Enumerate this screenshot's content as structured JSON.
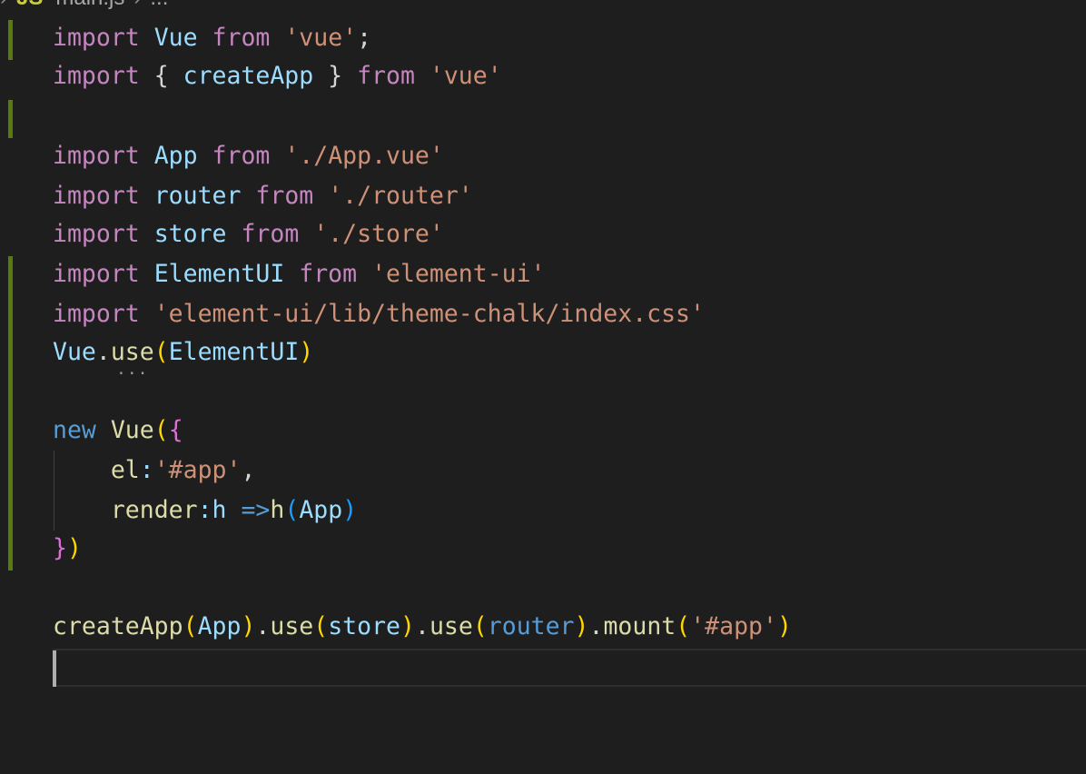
{
  "breadcrumb": {
    "file_icon_text": "JS",
    "file_name": "main.js",
    "trailing": "..."
  },
  "editor": {
    "lines": [
      {
        "tokens": [
          [
            "kw-ctrl",
            "import"
          ],
          [
            "p",
            " "
          ],
          [
            "id",
            "Vue"
          ],
          [
            "p",
            " "
          ],
          [
            "kw-ctrl",
            "from"
          ],
          [
            "p",
            " "
          ],
          [
            "str",
            "'vue'"
          ],
          [
            "p",
            ";"
          ]
        ]
      },
      {
        "tokens": [
          [
            "kw-ctrl",
            "import"
          ],
          [
            "p",
            " { "
          ],
          [
            "id",
            "createApp"
          ],
          [
            "p",
            " } "
          ],
          [
            "kw-ctrl",
            "from"
          ],
          [
            "p",
            " "
          ],
          [
            "str",
            "'vue'"
          ]
        ]
      },
      {
        "tokens": []
      },
      {
        "tokens": [
          [
            "kw-ctrl",
            "import"
          ],
          [
            "p",
            " "
          ],
          [
            "id",
            "App"
          ],
          [
            "p",
            " "
          ],
          [
            "kw-ctrl",
            "from"
          ],
          [
            "p",
            " "
          ],
          [
            "str",
            "'./App.vue'"
          ]
        ]
      },
      {
        "tokens": [
          [
            "kw-ctrl",
            "import"
          ],
          [
            "p",
            " "
          ],
          [
            "id",
            "router"
          ],
          [
            "p",
            " "
          ],
          [
            "kw-ctrl",
            "from"
          ],
          [
            "p",
            " "
          ],
          [
            "str",
            "'./router'"
          ]
        ]
      },
      {
        "tokens": [
          [
            "kw-ctrl",
            "import"
          ],
          [
            "p",
            " "
          ],
          [
            "id",
            "store"
          ],
          [
            "p",
            " "
          ],
          [
            "kw-ctrl",
            "from"
          ],
          [
            "p",
            " "
          ],
          [
            "str",
            "'./store'"
          ]
        ]
      },
      {
        "tokens": [
          [
            "kw-ctrl",
            "import"
          ],
          [
            "p",
            " "
          ],
          [
            "id",
            "ElementUI"
          ],
          [
            "p",
            " "
          ],
          [
            "kw-ctrl",
            "from"
          ],
          [
            "p",
            " "
          ],
          [
            "str",
            "'element-ui'"
          ]
        ]
      },
      {
        "tokens": [
          [
            "kw-ctrl",
            "import"
          ],
          [
            "p",
            " "
          ],
          [
            "str",
            "'element-ui/lib/theme-chalk/index.css'"
          ]
        ]
      },
      {
        "tokens": [
          [
            "id",
            "Vue"
          ],
          [
            "p",
            "."
          ],
          [
            "fn",
            "use"
          ],
          [
            "b1",
            "("
          ],
          [
            "id",
            "ElementUI"
          ],
          [
            "b1",
            ")"
          ]
        ]
      },
      {
        "tokens": []
      },
      {
        "tokens": [
          [
            "kw",
            "new"
          ],
          [
            "p",
            " "
          ],
          [
            "fn",
            "Vue"
          ],
          [
            "b1",
            "("
          ],
          [
            "b2",
            "{"
          ]
        ]
      },
      {
        "tokens": [
          [
            "p",
            "    "
          ],
          [
            "fn",
            "el"
          ],
          [
            "id",
            ":"
          ],
          [
            "str",
            "'#app'"
          ],
          [
            "p",
            ","
          ]
        ]
      },
      {
        "tokens": [
          [
            "p",
            "    "
          ],
          [
            "fn",
            "render"
          ],
          [
            "id",
            ":h"
          ],
          [
            "p",
            " "
          ],
          [
            "kw",
            "=>"
          ],
          [
            "fn",
            "h"
          ],
          [
            "b3",
            "("
          ],
          [
            "id",
            "App"
          ],
          [
            "b3",
            ")"
          ]
        ]
      },
      {
        "tokens": [
          [
            "b2",
            "}"
          ],
          [
            "b1",
            ")"
          ]
        ]
      },
      {
        "tokens": []
      },
      {
        "tokens": [
          [
            "fn",
            "createApp"
          ],
          [
            "b1",
            "("
          ],
          [
            "id",
            "App"
          ],
          [
            "b1",
            ")"
          ],
          [
            "p",
            "."
          ],
          [
            "fn",
            "use"
          ],
          [
            "b1",
            "("
          ],
          [
            "id",
            "store"
          ],
          [
            "b1",
            ")"
          ],
          [
            "p",
            "."
          ],
          [
            "fn",
            "use"
          ],
          [
            "b1",
            "("
          ],
          [
            "kw",
            "router"
          ],
          [
            "b1",
            ")"
          ],
          [
            "p",
            "."
          ],
          [
            "fn",
            "mount"
          ],
          [
            "b1",
            "("
          ],
          [
            "str",
            "'#app'"
          ],
          [
            "b1",
            ")"
          ]
        ]
      },
      {
        "tokens": []
      }
    ],
    "hint_dots": "...",
    "change_marker_color": "#587c0c"
  }
}
